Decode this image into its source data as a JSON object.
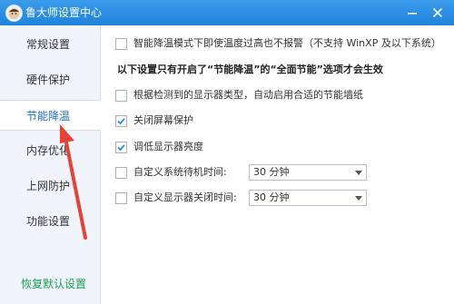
{
  "window": {
    "title": "鲁大师设置中心",
    "minimize_icon": "minimize-icon",
    "close_icon": "close-icon"
  },
  "sidebar": {
    "items": [
      {
        "label": "常规设置"
      },
      {
        "label": "硬件保护"
      },
      {
        "label": "节能降温",
        "active": true
      },
      {
        "label": "内存优化"
      },
      {
        "label": "上网防护"
      },
      {
        "label": "功能设置"
      }
    ],
    "restore_label": "恢复默认设置"
  },
  "content": {
    "smart_cooling": {
      "label": "智能降温模式下即使温度过高也不报警（不支持 WinXP 及以下系统）",
      "checked": false
    },
    "section_note": "以下设置只有开启了“节能降温”的“全面节能”选项才会生效",
    "options": [
      {
        "label": "根据检测到的显示器类型，自动启用合适的节能墙纸",
        "checked": false
      },
      {
        "label": "关闭屏幕保护",
        "checked": true
      },
      {
        "label": "调低显示器亮度",
        "checked": true
      }
    ],
    "standby": {
      "label": "自定义系统待机时间:",
      "checked": false,
      "value": "30 分钟"
    },
    "monitor_off": {
      "label": "自定义显示器关闭时间:",
      "checked": false,
      "value": "30 分钟"
    }
  },
  "colors": {
    "titlebar": "#1f84db",
    "accent": "#1a6fc9",
    "restore_link": "#1b9e53",
    "arrow": "#e8413a"
  }
}
